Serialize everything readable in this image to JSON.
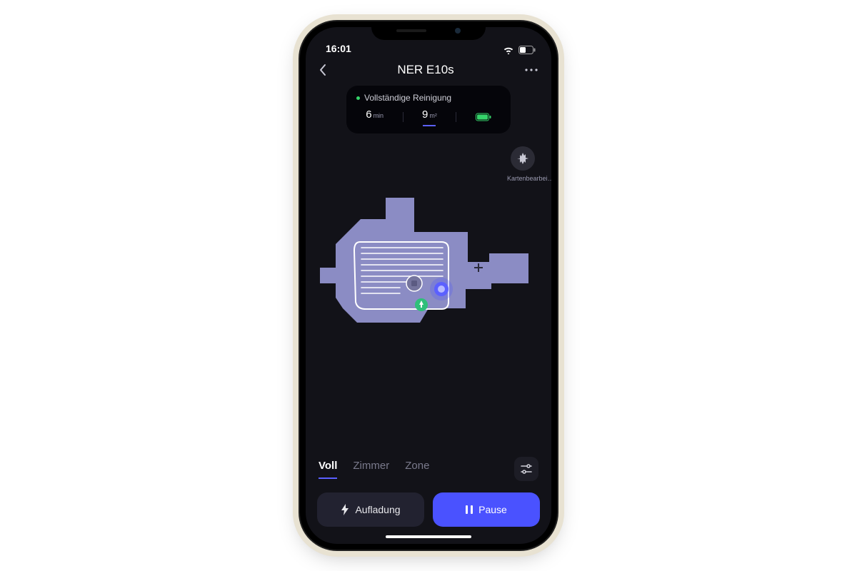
{
  "statusbar": {
    "time": "16:01"
  },
  "header": {
    "title": "NER E10s"
  },
  "statusCard": {
    "mode": "Vollständige Reinigung",
    "time_value": "6",
    "time_unit": "min",
    "area_value": "9",
    "area_unit": "m²"
  },
  "sideAction": {
    "label": "Kartenbearbei…"
  },
  "tabs": {
    "t1": "Voll",
    "t2": "Zimmer",
    "t3": "Zone"
  },
  "buttons": {
    "charge": "Aufladung",
    "pause": "Pause"
  },
  "colors": {
    "accent": "#4a52ff",
    "roomFill": "#8b8cc4",
    "bg": "#121218"
  }
}
